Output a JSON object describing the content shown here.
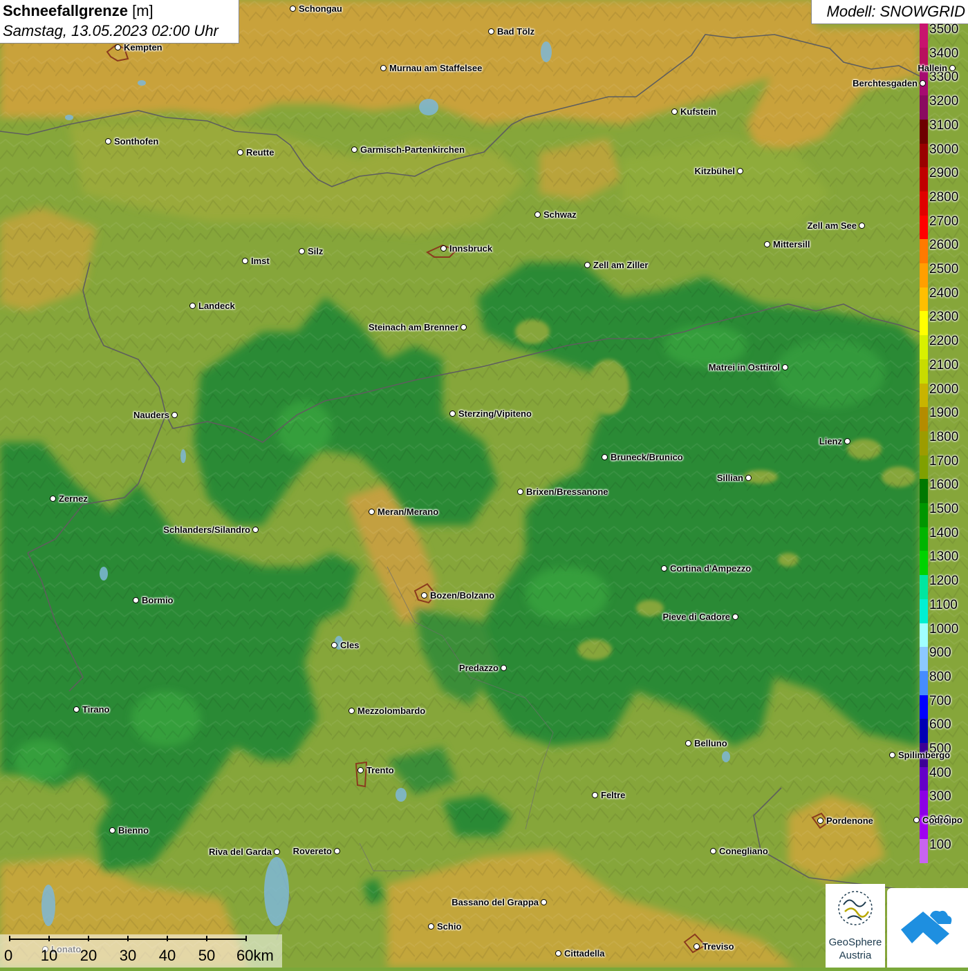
{
  "header": {
    "title_bold": "Schneefallgrenze",
    "title_unit": "[m]",
    "subtitle": "Samstag, 13.05.2023 02:00 Uhr",
    "model": "Modell: SNOWGRID"
  },
  "legend": {
    "labels": [
      "3500",
      "3400",
      "3300",
      "3200",
      "3100",
      "3000",
      "2900",
      "2800",
      "2700",
      "2600",
      "2500",
      "2400",
      "2300",
      "2200",
      "2100",
      "2000",
      "1900",
      "1800",
      "1700",
      "1600",
      "1500",
      "1400",
      "1300",
      "1200",
      "1100",
      "1000",
      "900",
      "800",
      "700",
      "600",
      "500",
      "400",
      "300",
      "200",
      "100"
    ],
    "colors": [
      "#c8146e",
      "#b8105e",
      "#a60c70",
      "#8a0a60",
      "#6e0000",
      "#9a0000",
      "#c00000",
      "#e00000",
      "#ff0000",
      "#ff7a00",
      "#ff9f00",
      "#ffbf00",
      "#ffff00",
      "#d8f000",
      "#c8dc00",
      "#c8b400",
      "#b48c00",
      "#9c9c00",
      "#80a000",
      "#007800",
      "#009600",
      "#00b400",
      "#00d200",
      "#00e6a0",
      "#00f0d2",
      "#a0ffff",
      "#8cc8ff",
      "#468cff",
      "#0000ff",
      "#0000b4",
      "#3c0096",
      "#6400c8",
      "#8c00e6",
      "#a000f0",
      "#c864f0"
    ]
  },
  "cities": [
    {
      "name": "Schongau"
    },
    {
      "name": "Kempten"
    },
    {
      "name": "Bad Tölz"
    },
    {
      "name": "Murnau am Staffelsee"
    },
    {
      "name": "Berchtesgaden"
    },
    {
      "name": "Hallein"
    },
    {
      "name": "Kufstein"
    },
    {
      "name": "Sonthofen"
    },
    {
      "name": "Reutte"
    },
    {
      "name": "Garmisch-Partenkirchen"
    },
    {
      "name": "Kitzbühel"
    },
    {
      "name": "Schwaz"
    },
    {
      "name": "Zell am See"
    },
    {
      "name": "Mittersill"
    },
    {
      "name": "Innsbruck"
    },
    {
      "name": "Silz"
    },
    {
      "name": "Imst"
    },
    {
      "name": "Zell am Ziller"
    },
    {
      "name": "Landeck"
    },
    {
      "name": "Steinach am Brenner"
    },
    {
      "name": "Matrei in Osttirol"
    },
    {
      "name": "Nauders"
    },
    {
      "name": "Sterzing/Vipiteno"
    },
    {
      "name": "Lienz"
    },
    {
      "name": "Bruneck/Brunico"
    },
    {
      "name": "Sillian"
    },
    {
      "name": "Brixen/Bressanone"
    },
    {
      "name": "Zernez"
    },
    {
      "name": "Meran/Merano"
    },
    {
      "name": "Schlanders/Silandro"
    },
    {
      "name": "Cortina d'Ampezzo"
    },
    {
      "name": "Bozen/Bolzano"
    },
    {
      "name": "Bormio"
    },
    {
      "name": "Pieve di Cadore"
    },
    {
      "name": "Cles"
    },
    {
      "name": "Predazzo"
    },
    {
      "name": "Tirano"
    },
    {
      "name": "Mezzolombardo"
    },
    {
      "name": "Belluno"
    },
    {
      "name": "Spilimbergo"
    },
    {
      "name": "Trento"
    },
    {
      "name": "Feltre"
    },
    {
      "name": "Pordenone"
    },
    {
      "name": "Codroipo"
    },
    {
      "name": "Bienno"
    },
    {
      "name": "Riva del Garda"
    },
    {
      "name": "Rovereto"
    },
    {
      "name": "Conegliano"
    },
    {
      "name": "Bassano del Grappa"
    },
    {
      "name": "Schio"
    },
    {
      "name": "Treviso"
    },
    {
      "name": "Cittadella"
    },
    {
      "name": "Lonato"
    }
  ],
  "scalebar": {
    "labels": [
      "0",
      "10",
      "20",
      "30",
      "40",
      "50",
      "60km"
    ]
  },
  "logo": {
    "line1": "GeoSphere",
    "line2": "Austria"
  },
  "colors": {
    "low_snowline": "#1f8a2e",
    "mid_snowline": "#8aa83a",
    "high_snowline": "#c9a43a"
  }
}
